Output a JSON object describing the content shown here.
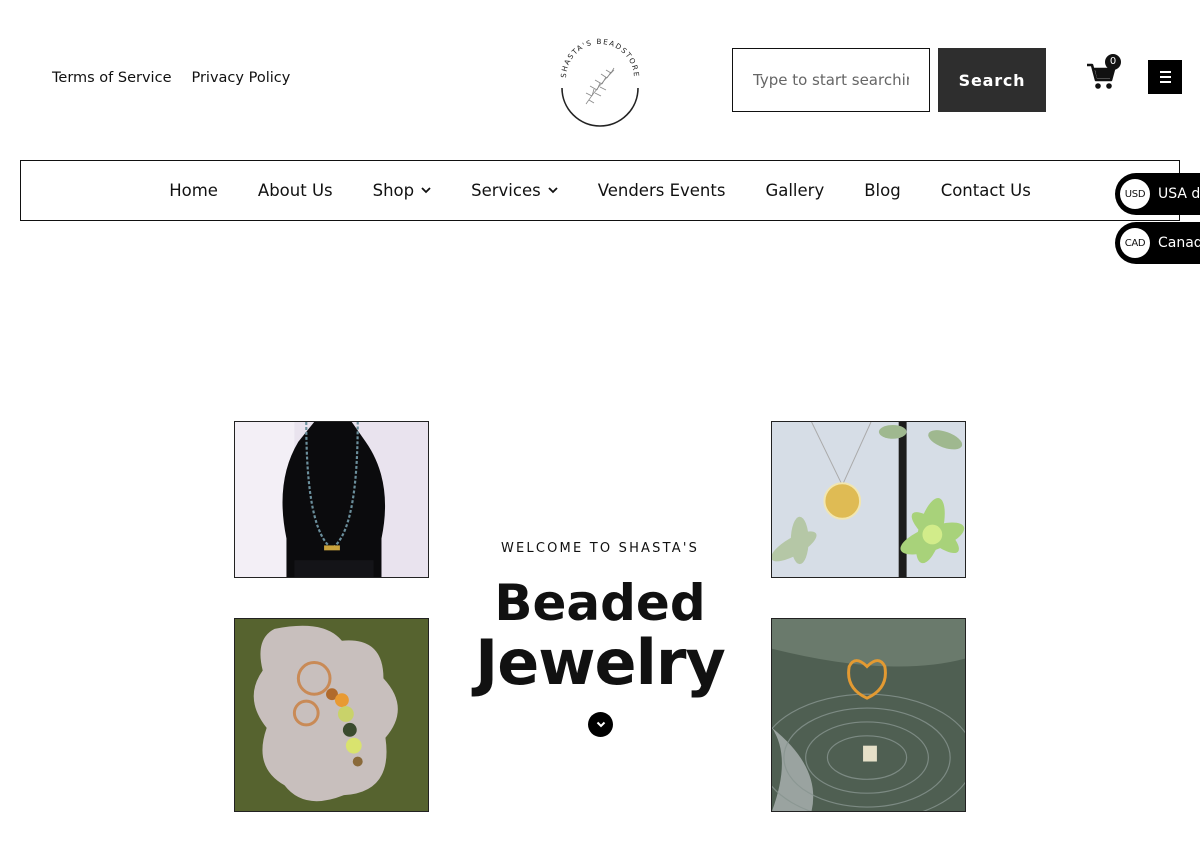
{
  "top_links": {
    "terms": "Terms of Service",
    "privacy": "Privacy Policy"
  },
  "logo": {
    "text": "SHASTA'S BEADSTORE",
    "icon": "fern-leaf-logo"
  },
  "search": {
    "placeholder": "Type to start searching...",
    "value": "",
    "button_label": "Search"
  },
  "cart": {
    "count": "0",
    "icon": "cart-icon"
  },
  "menu": {
    "icon": "hamburger-menu-icon"
  },
  "nav": {
    "home": "Home",
    "about": "About Us",
    "shop": "Shop",
    "services": "Services",
    "venders": "Venders Events",
    "gallery": "Gallery",
    "blog": "Blog",
    "contact": "Contact Us"
  },
  "currency": [
    {
      "code": "USD",
      "label": "USA dollar"
    },
    {
      "code": "CAD",
      "label": "Canadian dollar"
    }
  ],
  "hero": {
    "eyebrow": "WELCOME TO SHASTA'S",
    "title_line1": "Beaded",
    "title_line2": "Jewelry",
    "scroll_icon": "chevron-down-icon"
  },
  "colors": {
    "button_dark": "#2e2e2e",
    "border": "#111111",
    "background": "#ffffff"
  }
}
